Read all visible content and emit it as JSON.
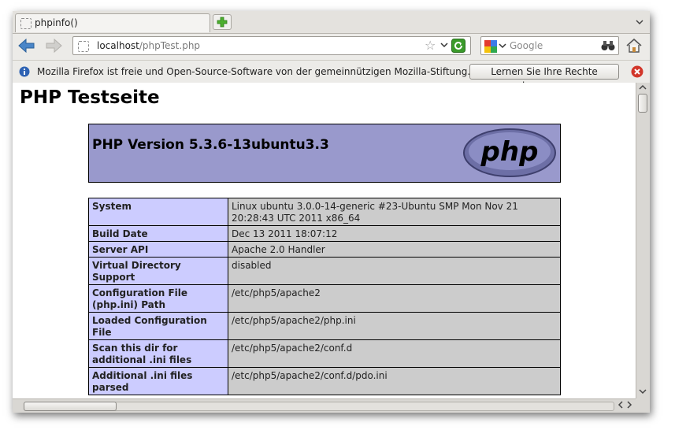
{
  "tab": {
    "title": "phpinfo()",
    "new_tab_icon": "plus-icon",
    "list_icon": "chevron-down"
  },
  "nav": {
    "url_host": "localhost",
    "url_path": "/phpTest.php",
    "bookmark_icon": "star-icon",
    "url_dropdown": "⌄",
    "search_placeholder": "Google",
    "search_dropdown": "⌄"
  },
  "notification": {
    "message": "Mozilla Firefox ist freie und Open-Source-Software von der gemeinnützigen Mozilla-Stiftung.",
    "button_label": "Lernen Sie Ihre Rechte kennen…"
  },
  "page": {
    "title": "PHP Testseite",
    "version": "PHP Version 5.3.6-13ubuntu3.3",
    "logo_text": "php",
    "rows": [
      {
        "key": "System",
        "value": "Linux ubuntu 3.0.0-14-generic #23-Ubuntu SMP Mon Nov 21 20:28:43 UTC 2011 x86_64"
      },
      {
        "key": "Build Date",
        "value": "Dec 13 2011 18:07:12"
      },
      {
        "key": "Server API",
        "value": "Apache 2.0 Handler"
      },
      {
        "key": "Virtual Directory Support",
        "value": "disabled"
      },
      {
        "key": "Configuration File (php.ini) Path",
        "value": "/etc/php5/apache2"
      },
      {
        "key": "Loaded Configuration File",
        "value": "/etc/php5/apache2/php.ini"
      },
      {
        "key": "Scan this dir for additional .ini files",
        "value": "/etc/php5/apache2/conf.d"
      },
      {
        "key": "Additional .ini files parsed",
        "value": "/etc/php5/apache2/conf.d/pdo.ini"
      }
    ]
  },
  "colors": {
    "php_header": "#9999cc",
    "key_cell": "#ccccff",
    "value_cell": "#cccccc",
    "chrome": "#ecebe8"
  }
}
